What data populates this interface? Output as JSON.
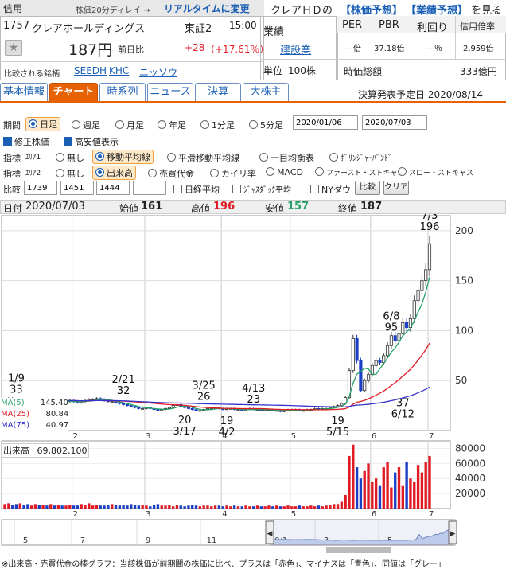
{
  "header": {
    "credit_label": "信用",
    "delay_note": "株価20分ディレイ →",
    "realtime_link": "リアルタイムに変更",
    "code": "1757",
    "name": "クレアホールディングス",
    "market": "東証2",
    "time": "15:00",
    "price": "187円",
    "change_label": "前日比",
    "change": "+28",
    "change_pct": "（+17.61％）",
    "compare_label": "比較される銘柄",
    "compare_links": [
      "SEEDH",
      "KHC",
      "ニッソウ"
    ],
    "forecast_prefix": "クレアＨＤの",
    "forecast_stock": "【株価予想】",
    "forecast_perf": "【業績予想】",
    "forecast_suffix": "を見る",
    "industry_label": "業績",
    "industry_dash": "—",
    "industry_link": "建設業",
    "unit_label": "単位",
    "unit_value": "100株",
    "per_label": "PER",
    "pbr_label": "PBR",
    "yield_label": "利回り",
    "margin_label": "信用倍率",
    "per_value": "—倍",
    "pbr_value": "37.18倍",
    "yield_value": "—％",
    "margin_value": "2,959倍",
    "mcap_label": "時価総額",
    "mcap_value": "333億円"
  },
  "tabs": [
    "基本情報",
    "チャート",
    "時系列",
    "ニュース",
    "決算",
    "大株主"
  ],
  "earnings_date": "決算発表予定日  2020/08/14",
  "controls": {
    "period_label": "期間",
    "period_options": [
      "日足",
      "週足",
      "月足",
      "年足",
      "1分足",
      "5分足"
    ],
    "date_from": "2020/01/06",
    "date_to": "2020/07/03",
    "adj_price": "修正株価",
    "high_low": "高安値表示",
    "ind1_label": "指標",
    "area1": "ｴﾘｱ1",
    "ind1_options": [
      "無し",
      "移動平均線",
      "平滑移動平均線",
      "一目均衡表",
      "ﾎﾞﾘﾝｼﾞｬｰﾊﾞﾝﾄﾞ"
    ],
    "ind2_label": "指標",
    "area2": "ｴﾘｱ2",
    "ind2_options": [
      "無し",
      "出来高",
      "売買代金",
      "カイリ率",
      "MACD",
      "ファースト・ストキャス",
      "スロー・ストキャス"
    ],
    "cmp_label": "比較",
    "cmp_values": [
      "1739",
      "1451",
      "1444",
      ""
    ],
    "nikkei": "日経平均",
    "jasdaq": "ｼﾞｬｽﾀﾞｯｸ平均",
    "nydow": "NYダウ",
    "compare_btn": "比較",
    "clear_btn": "クリア"
  },
  "ohlc_bar": {
    "date_label": "日付",
    "date": "2020/07/03",
    "open_label": "始値",
    "open": "161",
    "high_label": "高値",
    "high": "196",
    "low_label": "安値",
    "low": "157",
    "close_label": "終値",
    "close": "187"
  },
  "ma_legend": [
    {
      "label": "MA(5)",
      "value": "145.40",
      "color": "#26a269"
    },
    {
      "label": "MA(25)",
      "value": "80.84",
      "color": "#e01b24"
    },
    {
      "label": "MA(75)",
      "value": "40.97",
      "color": "#3333cc"
    }
  ],
  "volume_label": "出来高",
  "volume_value": "69,802,100",
  "footer_note": "※出来高・売買代金の棒グラフ：当該株価が前期間の株価に比べ、プラスは「赤色」、マイナスは「青色」、同値は「グレー」",
  "colors": {
    "up": "#e01b24",
    "down": "#1a3fc4",
    "accent": "#e66100",
    "link": "#1a5fb4"
  },
  "chart_data": {
    "type": "candlestick",
    "y_ticks": [
      50,
      100,
      150,
      200
    ],
    "ylim": [
      0,
      215
    ],
    "x_month_labels": [
      "2",
      "3",
      "4",
      "5",
      "6",
      "7"
    ],
    "annotations": [
      {
        "date": "1/9",
        "value": 33,
        "pos": "above"
      },
      {
        "date": "2/21",
        "value": 32,
        "pos": "above"
      },
      {
        "date": "3/17",
        "value": 20,
        "pos": "below"
      },
      {
        "date": "3/25",
        "value": 26,
        "pos": "above"
      },
      {
        "date": "4/2",
        "value": 19,
        "pos": "below"
      },
      {
        "date": "4/13",
        "value": 23,
        "pos": "above"
      },
      {
        "date": "5/15",
        "value": 19,
        "pos": "below"
      },
      {
        "date": "6/8",
        "value": 95,
        "pos": "above"
      },
      {
        "date": "6/12",
        "value": 37,
        "pos": "below"
      },
      {
        "date": "7/3",
        "value": 196,
        "pos": "above"
      }
    ],
    "close": [
      31,
      32,
      31,
      30,
      31,
      30,
      29,
      30,
      31,
      30,
      30,
      29,
      30,
      29,
      29,
      28,
      29,
      30,
      29,
      28,
      29,
      30,
      31,
      31,
      32,
      31,
      30,
      29,
      29,
      28,
      27,
      26,
      25,
      24,
      23,
      22,
      22,
      23,
      22,
      21,
      20,
      21,
      22,
      23,
      25,
      26,
      24,
      23,
      22,
      21,
      20,
      20,
      21,
      22,
      22,
      23,
      22,
      21,
      22,
      22,
      21,
      21,
      20,
      21,
      22,
      21,
      21,
      20,
      21,
      21,
      20,
      20,
      19,
      20,
      21,
      21,
      21,
      20,
      20,
      21,
      21,
      22,
      21,
      22,
      22,
      23,
      24,
      25,
      27,
      33,
      60,
      92,
      70,
      40,
      50,
      56,
      65,
      70,
      68,
      75,
      85,
      95,
      90,
      97,
      108,
      103,
      112,
      130,
      140,
      150,
      161,
      187
    ],
    "volume_ylim": [
      0,
      90000
    ],
    "volume_ticks": [
      20000,
      40000,
      60000,
      80000
    ],
    "volume": [
      6,
      7,
      5,
      6,
      7,
      5,
      6,
      4,
      6,
      5,
      5,
      4,
      6,
      4,
      5,
      4,
      4,
      5,
      4,
      4,
      6,
      5,
      7,
      4,
      5,
      4,
      4,
      5,
      6,
      5,
      4,
      5,
      4,
      6,
      5,
      4,
      5,
      4,
      3,
      5,
      6,
      4,
      4,
      5,
      3,
      5,
      4,
      3,
      4,
      5,
      4,
      3,
      4,
      4,
      3,
      4,
      4,
      3,
      4,
      3,
      4,
      3,
      3,
      4,
      3,
      3,
      4,
      3,
      3,
      4,
      3,
      4,
      3,
      3,
      4,
      3,
      3,
      4,
      3,
      3,
      4,
      3,
      4,
      3,
      4,
      5,
      6,
      6,
      9,
      18,
      70,
      85,
      55,
      40,
      50,
      60,
      35,
      40,
      30,
      55,
      62,
      28,
      48,
      55,
      30,
      62,
      40,
      35,
      58,
      48,
      62,
      70
    ],
    "navigator_labels": [
      "5",
      "7",
      "9",
      "11",
      "20/1",
      "3",
      "5"
    ]
  }
}
